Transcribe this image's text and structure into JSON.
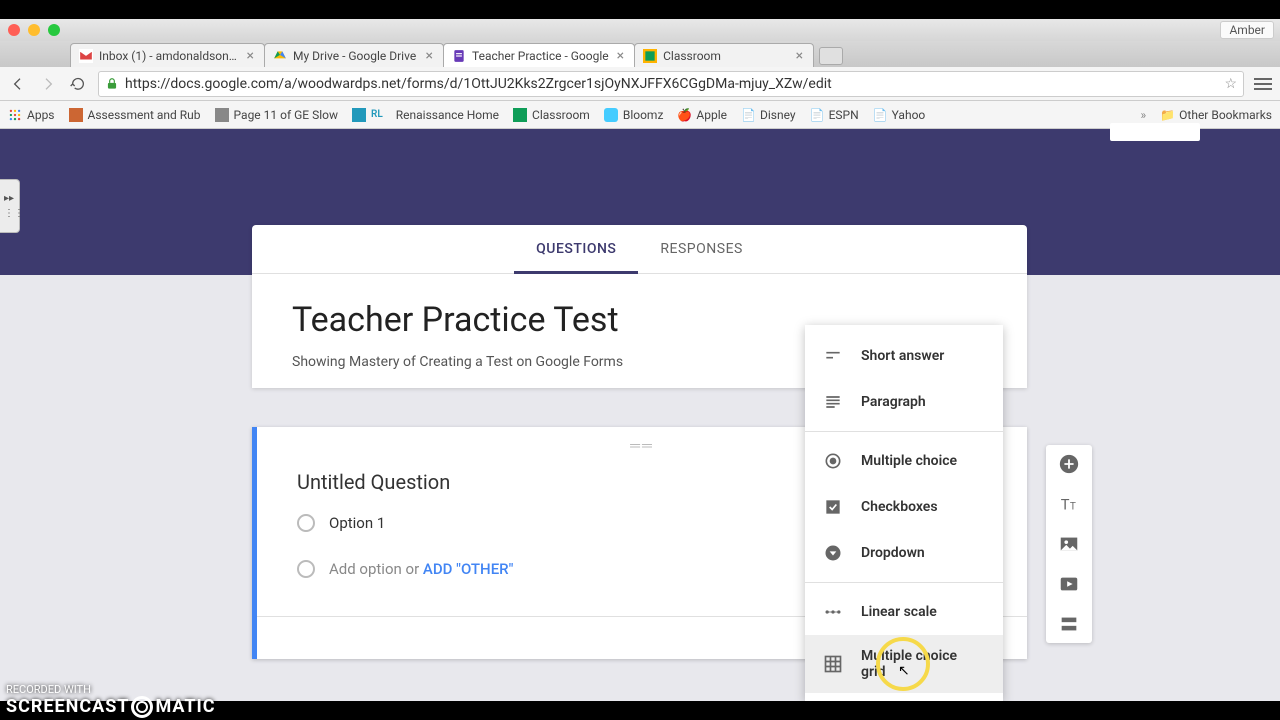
{
  "window": {
    "user_badge": "Amber"
  },
  "tabs": [
    {
      "label": "Inbox (1) - amdonaldson@v"
    },
    {
      "label": "My Drive - Google Drive"
    },
    {
      "label": "Teacher Practice - Google",
      "active": true
    },
    {
      "label": "Classroom"
    }
  ],
  "address_bar": {
    "url": "https://docs.google.com/a/woodwardps.net/forms/d/1OttJU2Kks2Zrgcer1sjOyNXJFFX6CGgDMa-mjuy_XZw/edit"
  },
  "bookmarks": [
    {
      "label": "Apps"
    },
    {
      "label": "Assessment and Rub"
    },
    {
      "label": "Page 11 of GE Slow"
    },
    {
      "label": "Renaissance Home"
    },
    {
      "label": "Classroom"
    },
    {
      "label": "Bloomz"
    },
    {
      "label": "Apple"
    },
    {
      "label": "Disney"
    },
    {
      "label": "ESPN"
    },
    {
      "label": "Yahoo"
    }
  ],
  "bookmarks_overflow": "»",
  "other_bookmarks": "Other Bookmarks",
  "form": {
    "tab_questions": "QUESTIONS",
    "tab_responses": "RESPONSES",
    "title": "Teacher Practice Test",
    "description": "Showing Mastery of Creating a Test on Google Forms"
  },
  "question": {
    "title": "Untitled Question",
    "option1": "Option 1",
    "add_option": "Add option",
    "or": " or ",
    "add_other": "ADD \"OTHER\""
  },
  "qtype_menu": {
    "short_answer": "Short answer",
    "paragraph": "Paragraph",
    "multiple_choice": "Multiple choice",
    "checkboxes": "Checkboxes",
    "dropdown": "Dropdown",
    "linear_scale": "Linear scale",
    "mc_grid": "Multiple choice grid"
  },
  "watermark": {
    "line1": "RECORDED WITH",
    "brand_a": "SCREENCAST",
    "brand_b": "MATIC"
  }
}
